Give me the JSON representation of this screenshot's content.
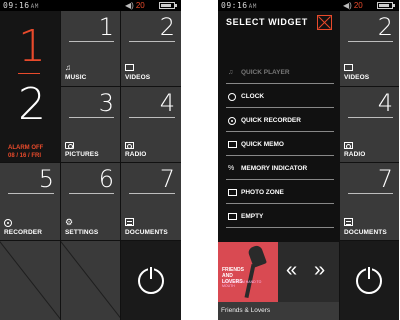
{
  "left_screen": {
    "status": {
      "time": "09:16",
      "ampm": "AM",
      "volume": "20"
    },
    "clock": {
      "hour": "1",
      "minute": "2"
    },
    "alarm": {
      "status": "ALARM OFF",
      "date": "08 / 16 / FRI"
    },
    "tiles": [
      {
        "num": "1",
        "label": "MUSIC",
        "icon": "music-icon"
      },
      {
        "num": "2",
        "label": "VIDEOS",
        "icon": "video-icon"
      },
      {
        "num": "3",
        "label": "PICTURES",
        "icon": "camera-icon"
      },
      {
        "num": "4",
        "label": "RADIO",
        "icon": "radio-icon"
      },
      {
        "num": "5",
        "label": "RECORDER",
        "icon": "record-icon"
      },
      {
        "num": "6",
        "label": "SETTINGS",
        "icon": "gear-icon"
      },
      {
        "num": "7",
        "label": "DOCUMENTS",
        "icon": "document-icon"
      }
    ]
  },
  "right_screen": {
    "status": {
      "time": "09:16",
      "ampm": "AM",
      "volume": "20"
    },
    "widget_panel": {
      "title": "SELECT WIDGET",
      "items": [
        {
          "label": "QUICK PLAYER",
          "icon": "music-icon",
          "dimmed": true
        },
        {
          "label": "CLOCK",
          "icon": "clock-icon"
        },
        {
          "label": "QUICK RECORDER",
          "icon": "record-icon"
        },
        {
          "label": "QUICK MEMO",
          "icon": "memo-icon"
        },
        {
          "label": "MEMORY INDICATOR",
          "icon": "percent-icon"
        },
        {
          "label": "PHOTO ZONE",
          "icon": "camera-icon"
        },
        {
          "label": "EMPTY",
          "icon": "empty-icon"
        }
      ]
    },
    "tiles": [
      {
        "num": "2",
        "label": "VIDEOS"
      },
      {
        "num": "4",
        "label": "RADIO"
      },
      {
        "num": "7",
        "label": "DOCUMENTS"
      }
    ],
    "player": {
      "album_title": "FRIENDS AND LOVERS",
      "album_sub": "LIVING FROM HAND TO MOUTH",
      "song": "Friends & Lovers",
      "rewind": "«",
      "forward": "»"
    }
  },
  "colors": {
    "accent": "#e84a2b",
    "tile": "#3a3a3a",
    "background": "#111111"
  }
}
